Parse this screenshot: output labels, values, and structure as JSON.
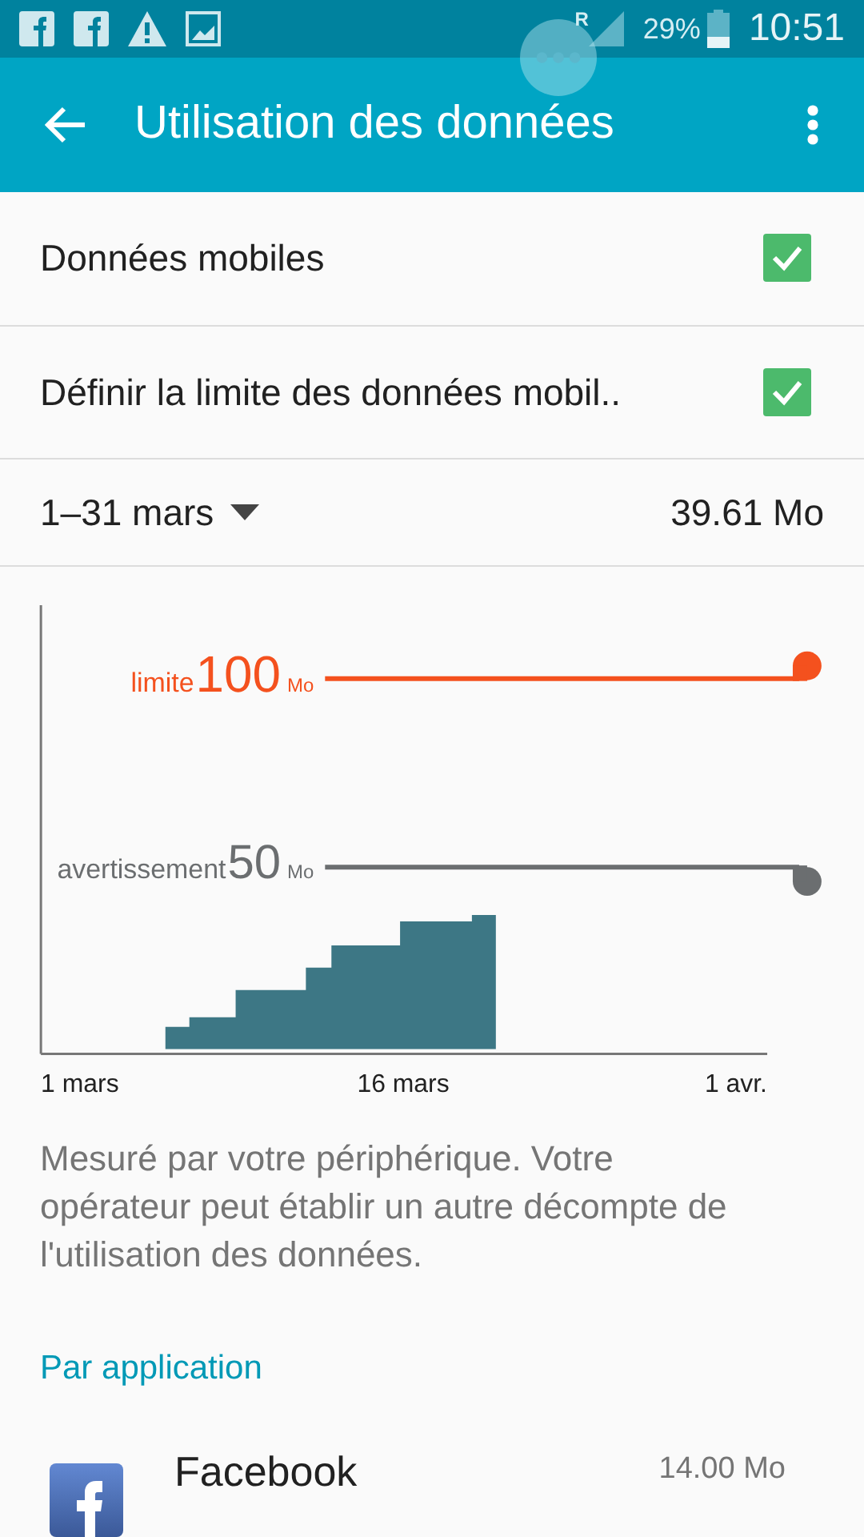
{
  "status_bar": {
    "network": "R",
    "battery": "29%",
    "time": "10:51"
  },
  "app_bar": {
    "title": "Utilisation des données"
  },
  "settings": [
    {
      "label": "Données mobiles",
      "checked": true
    },
    {
      "label": "Définir la limite des données mobil..",
      "checked": true
    }
  ],
  "period": {
    "range": "1–31 mars",
    "total": "39.61 Mo"
  },
  "chart": {
    "limit": {
      "label": "limite",
      "value": "100",
      "unit": "Mo"
    },
    "warning": {
      "label": "avertissement",
      "value": "50",
      "unit": "Mo"
    },
    "x_labels": [
      "1 mars",
      "16 mars",
      "1 avr."
    ]
  },
  "note": "Mesuré par votre périphérique. Votre opérateur peut établir un autre décompte de l'utilisation des données.",
  "section_title": "Par application",
  "apps": [
    {
      "name": "Facebook",
      "usage": "14.00 Mo"
    }
  ]
}
